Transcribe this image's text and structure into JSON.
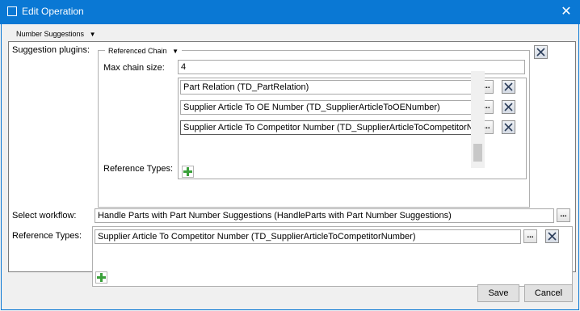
{
  "window": {
    "title": "Edit Operation",
    "close_glyph": "✕",
    "app_icon": "window-icon"
  },
  "number_suggestions": {
    "header": "Number Suggestions",
    "suggestion_plugins_label": "Suggestion plugins:",
    "referenced_chain": {
      "header": "Referenced Chain",
      "max_chain_size_label": "Max chain size:",
      "max_chain_size_value": "4",
      "reference_types_label": "Reference Types:",
      "items": [
        {
          "value": "Part Relation (TD_PartRelation)"
        },
        {
          "value": "Supplier Article To OE Number (TD_SupplierArticleToOENumber)"
        },
        {
          "value": "Supplier Article To Competitor Number (TD_SupplierArticleToCompetitorNumber)"
        }
      ]
    },
    "select_workflow_label": "Select workflow:",
    "select_workflow_value": "Handle Parts with Part Number Suggestions (HandleParts with Part Number Suggestions)",
    "reference_types_label": "Reference Types:",
    "reference_types_value": "Supplier Article To Competitor Number (TD_SupplierArticleToCompetitorNumber)"
  },
  "buttons": {
    "dots": "...",
    "save": "Save",
    "cancel": "Cancel"
  },
  "colors": {
    "titlebar": "#0a78d4",
    "remove_red": "#c00000",
    "add_green": "#3aa03a"
  }
}
